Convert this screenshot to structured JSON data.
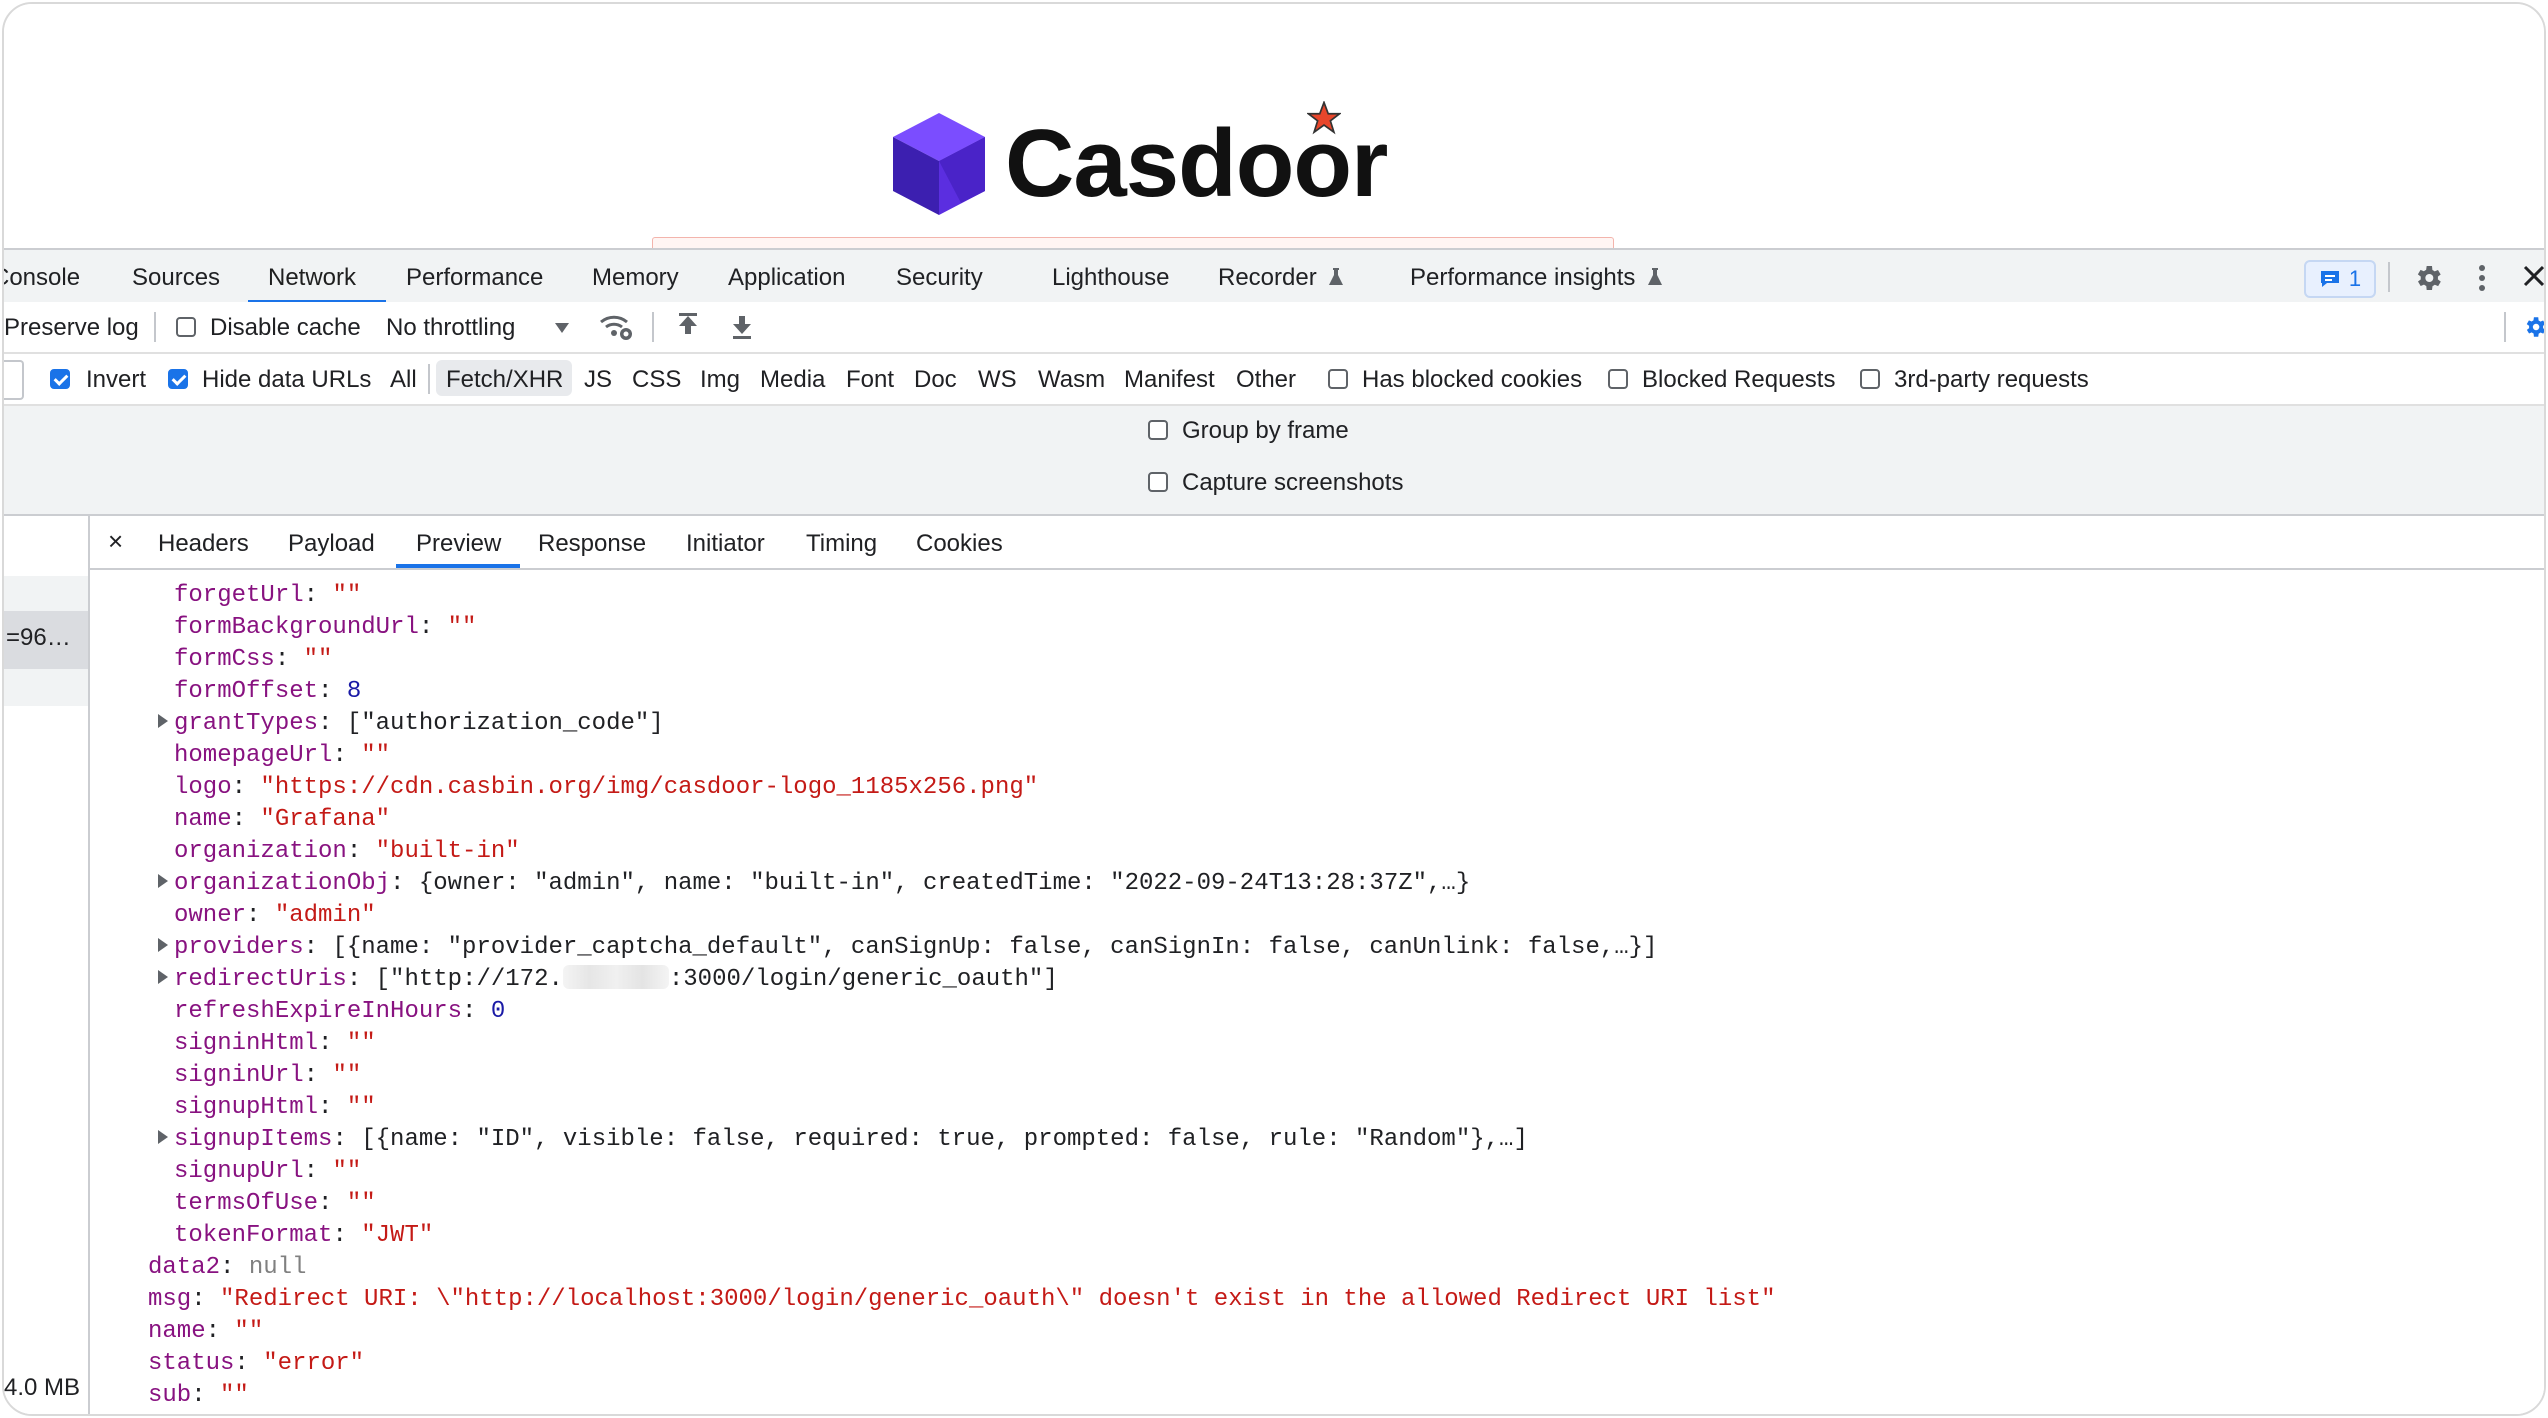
{
  "brand": {
    "name": "Casdoor",
    "colors": {
      "cube": "#5b2ee0",
      "star": "#e8462b"
    }
  },
  "devtools": {
    "tabs": [
      {
        "label": "Console"
      },
      {
        "label": "Sources"
      },
      {
        "label": "Network"
      },
      {
        "label": "Performance"
      },
      {
        "label": "Memory"
      },
      {
        "label": "Application"
      },
      {
        "label": "Security"
      },
      {
        "label": "Lighthouse"
      },
      {
        "label": "Recorder"
      },
      {
        "label": "Performance insights"
      }
    ],
    "active_tab": "Network",
    "issues_count": "1",
    "accent": "#1a73e8"
  },
  "toolbar": {
    "preserve_log": "Preserve log",
    "disable_cache": "Disable cache",
    "throttling": "No throttling"
  },
  "filters": {
    "invert": "Invert",
    "hide_data_urls": "Hide data URLs",
    "types": [
      "All",
      "Fetch/XHR",
      "JS",
      "CSS",
      "Img",
      "Media",
      "Font",
      "Doc",
      "WS",
      "Wasm",
      "Manifest",
      "Other"
    ],
    "active_type": "Fetch/XHR",
    "has_blocked_cookies": "Has blocked cookies",
    "blocked_requests": "Blocked Requests",
    "third_party": "3rd-party requests"
  },
  "settings": {
    "group_by_frame": "Group by frame",
    "capture_screenshots": "Capture screenshots"
  },
  "request_list": {
    "selected_name_fragment": "=96…",
    "footer_size": "4.0 MB"
  },
  "detail": {
    "close_glyph": "×",
    "tabs": [
      "Headers",
      "Payload",
      "Preview",
      "Response",
      "Initiator",
      "Timing",
      "Cookies"
    ],
    "active_tab": "Preview"
  },
  "preview_lines": [
    {
      "indent": 1,
      "key": "forgetUrl",
      "val": "\"\"",
      "type": "str"
    },
    {
      "indent": 1,
      "key": "formBackgroundUrl",
      "val": "\"\"",
      "type": "str"
    },
    {
      "indent": 1,
      "key": "formCss",
      "val": "\"\"",
      "type": "str"
    },
    {
      "indent": 1,
      "key": "formOffset",
      "val": "8",
      "type": "num"
    },
    {
      "indent": 1,
      "expand": true,
      "key": "grantTypes",
      "val": "[\"authorization_code\"]",
      "type": "plain"
    },
    {
      "indent": 1,
      "key": "homepageUrl",
      "val": "\"\"",
      "type": "str"
    },
    {
      "indent": 1,
      "key": "logo",
      "val": "\"https://cdn.casbin.org/img/casdoor-logo_1185x256.png\"",
      "type": "str"
    },
    {
      "indent": 1,
      "key": "name",
      "val": "\"Grafana\"",
      "type": "str"
    },
    {
      "indent": 1,
      "key": "organization",
      "val": "\"built-in\"",
      "type": "str"
    },
    {
      "indent": 1,
      "expand": true,
      "key": "organizationObj",
      "val": "{owner: \"admin\", name: \"built-in\", createdTime: \"2022-09-24T13:28:37Z\",…}",
      "type": "plain"
    },
    {
      "indent": 1,
      "key": "owner",
      "val": "\"admin\"",
      "type": "str"
    },
    {
      "indent": 1,
      "expand": true,
      "key": "providers",
      "val": "[{name: \"provider_captcha_default\", canSignUp: false, canSignIn: false, canUnlink: false,…}]",
      "type": "plain"
    },
    {
      "indent": 1,
      "expand": true,
      "key": "redirectUris",
      "val_pre": "[\"http://172.",
      "val_post": ":3000/login/generic_oauth\"]",
      "type": "redacted"
    },
    {
      "indent": 1,
      "key": "refreshExpireInHours",
      "val": "0",
      "type": "num"
    },
    {
      "indent": 1,
      "key": "signinHtml",
      "val": "\"\"",
      "type": "str"
    },
    {
      "indent": 1,
      "key": "signinUrl",
      "val": "\"\"",
      "type": "str"
    },
    {
      "indent": 1,
      "key": "signupHtml",
      "val": "\"\"",
      "type": "str"
    },
    {
      "indent": 1,
      "expand": true,
      "key": "signupItems",
      "val": "[{name: \"ID\", visible: false, required: true, prompted: false, rule: \"Random\"},…]",
      "type": "plain"
    },
    {
      "indent": 1,
      "key": "signupUrl",
      "val": "\"\"",
      "type": "str"
    },
    {
      "indent": 1,
      "key": "termsOfUse",
      "val": "\"\"",
      "type": "str"
    },
    {
      "indent": 1,
      "key": "tokenFormat",
      "val": "\"JWT\"",
      "type": "str"
    },
    {
      "indent": 0,
      "key": "data2",
      "val": "null",
      "type": "nul"
    },
    {
      "indent": 0,
      "key": "msg",
      "val": "\"Redirect URI: \\\"http://localhost:3000/login/generic_oauth\\\" doesn't exist in the allowed Redirect URI list\"",
      "type": "str"
    },
    {
      "indent": 0,
      "key": "name",
      "val": "\"\"",
      "type": "str"
    },
    {
      "indent": 0,
      "key": "status",
      "val": "\"error\"",
      "type": "str"
    },
    {
      "indent": 0,
      "key": "sub",
      "val": "\"\"",
      "type": "str"
    }
  ]
}
